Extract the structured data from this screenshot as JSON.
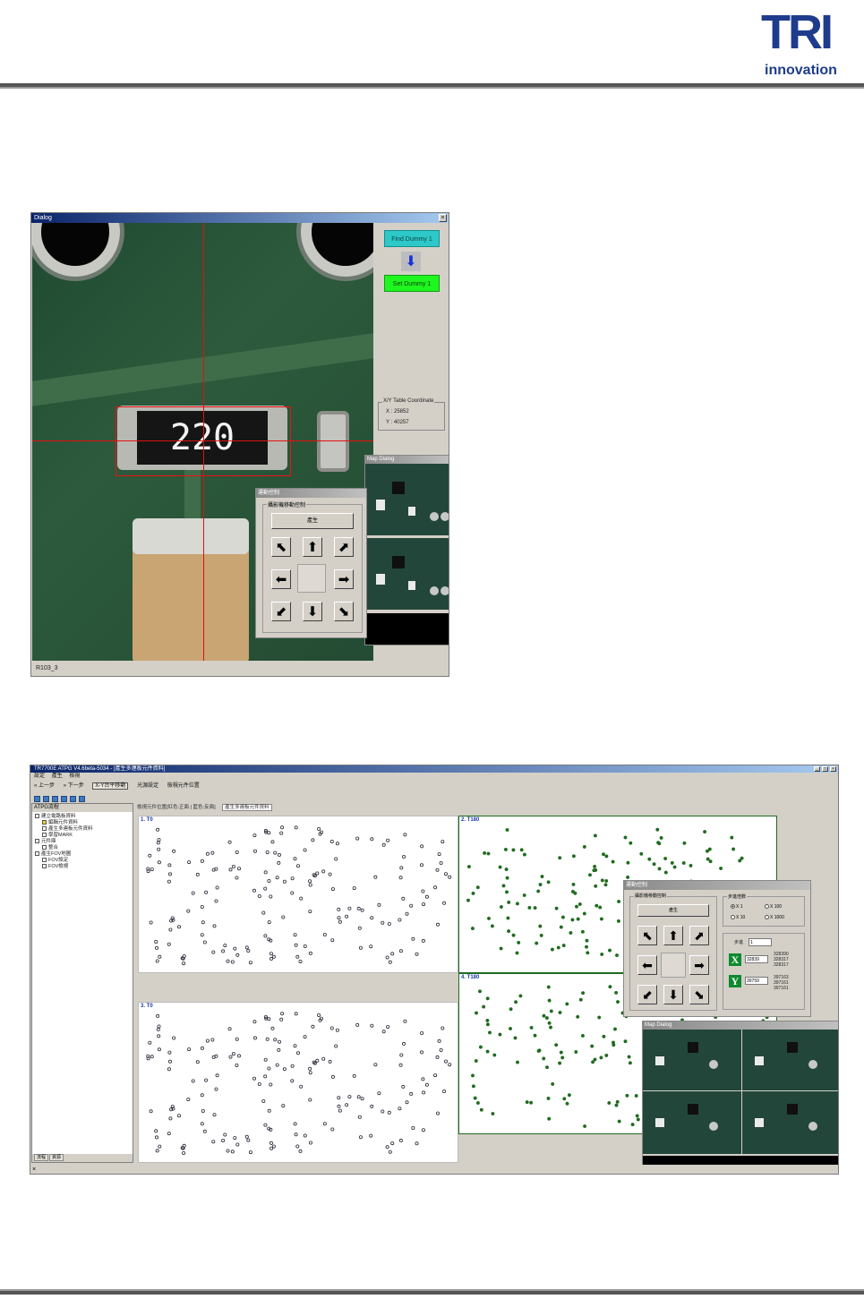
{
  "logo": {
    "mark": "TRI",
    "sub": "innovation"
  },
  "dialog1": {
    "title": "Dialog",
    "close": "×",
    "find_button": "Find Dummy 1",
    "arrow": "⬇",
    "set_button": "Set Dummy 1",
    "coord_legend": "X/Y Table Coordinate",
    "x_readout": "X : 25852",
    "y_readout": "Y : 40257",
    "part_marking": "220",
    "status": "R103_3",
    "motion": {
      "title": "運動控制",
      "group_label": "攝影機移動控制",
      "generate_button": "產生",
      "arrows": {
        "nw": "⬉",
        "n": "⬆",
        "ne": "⬈",
        "w": "⬅",
        "e": "➡",
        "sw": "⬋",
        "s": "⬇",
        "se": "⬊"
      }
    },
    "map_title": "Map Dialog"
  },
  "dialog2": {
    "title": "TR7700E ATPG V4.6beta-5034 - [產生多連板元件資料]",
    "controls": {
      "min": "_",
      "max": "□",
      "close": "×"
    },
    "menu": [
      "設定",
      "產生",
      "檢視"
    ],
    "toolbar": {
      "prev": "« 上一步",
      "next": "» 下一步",
      "xy_move": "X-Y台平移動",
      "light": "光源設定",
      "check_pos": "檢視元件位置"
    },
    "sidebar_title": "ATPG流程",
    "tree": [
      {
        "label": "建立電路板資料",
        "level": 0
      },
      {
        "label": "編輯元件資料",
        "level": 1
      },
      {
        "label": "產生多連板元件資料",
        "level": 1
      },
      {
        "label": "學習MARK",
        "level": 1
      },
      {
        "label": "元件庫",
        "level": 0
      },
      {
        "label": "整合",
        "level": 1
      },
      {
        "label": "產生FOV地圖",
        "level": 0
      },
      {
        "label": "FOV設定",
        "level": 1
      },
      {
        "label": "FOV檢視",
        "level": 1
      }
    ],
    "sidebar_tabs": [
      "流程",
      "資源"
    ],
    "doc_tabs": [
      "檢視元件位置[紅色:正面 | 藍色:反面]",
      "產生多連板元件資料"
    ],
    "panels": [
      {
        "label": "1. T0"
      },
      {
        "label": "2. T180"
      },
      {
        "label": "3. T0"
      },
      {
        "label": "4. T180"
      }
    ],
    "motion": {
      "title": "運動控制",
      "group_label": "攝影機移動控制",
      "generate_button": "產生",
      "step_legend": "步進倍數",
      "steps": [
        "X 1",
        "X 100",
        "X 10",
        "X 1000"
      ],
      "step_label": "步進",
      "step_value": "1",
      "x_badge": "X",
      "y_badge": "Y",
      "x_value": "32839",
      "y_value": "39759",
      "x_list": [
        "328390",
        "328317",
        "328317"
      ],
      "y_list": [
        "397163",
        "397161",
        "397161"
      ]
    },
    "map_title": "Map Dialog",
    "status": "×"
  },
  "colors": {
    "brand": "#1f3c8c",
    "cyan_button": "#2ec8c8",
    "green_button": "#1ff51f",
    "trace_green": "#1f6b1f",
    "crosshair": "#e01010"
  }
}
